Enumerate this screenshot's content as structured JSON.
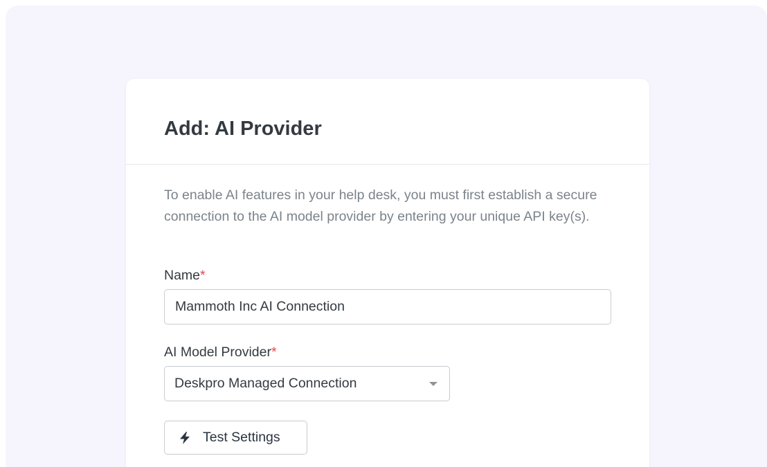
{
  "form": {
    "title": "Add: AI Provider",
    "intro": "To enable AI features in your help desk, you must first establish a secure connection to the AI model provider by entering your unique API key(s).",
    "required_marker": "*",
    "name_label": "Name",
    "name_value": "Mammoth Inc AI Connection",
    "provider_label": "AI Model Provider",
    "provider_value": "Deskpro Managed Connection",
    "test_button_label": "Test Settings",
    "test_button_icon": "lightning-bolt-icon",
    "dropdown_icon": "caret-down-icon"
  },
  "colors": {
    "background": "#f6f5fd",
    "required": "#e5484d",
    "text": "#343a40",
    "muted_text": "#7b838b"
  }
}
